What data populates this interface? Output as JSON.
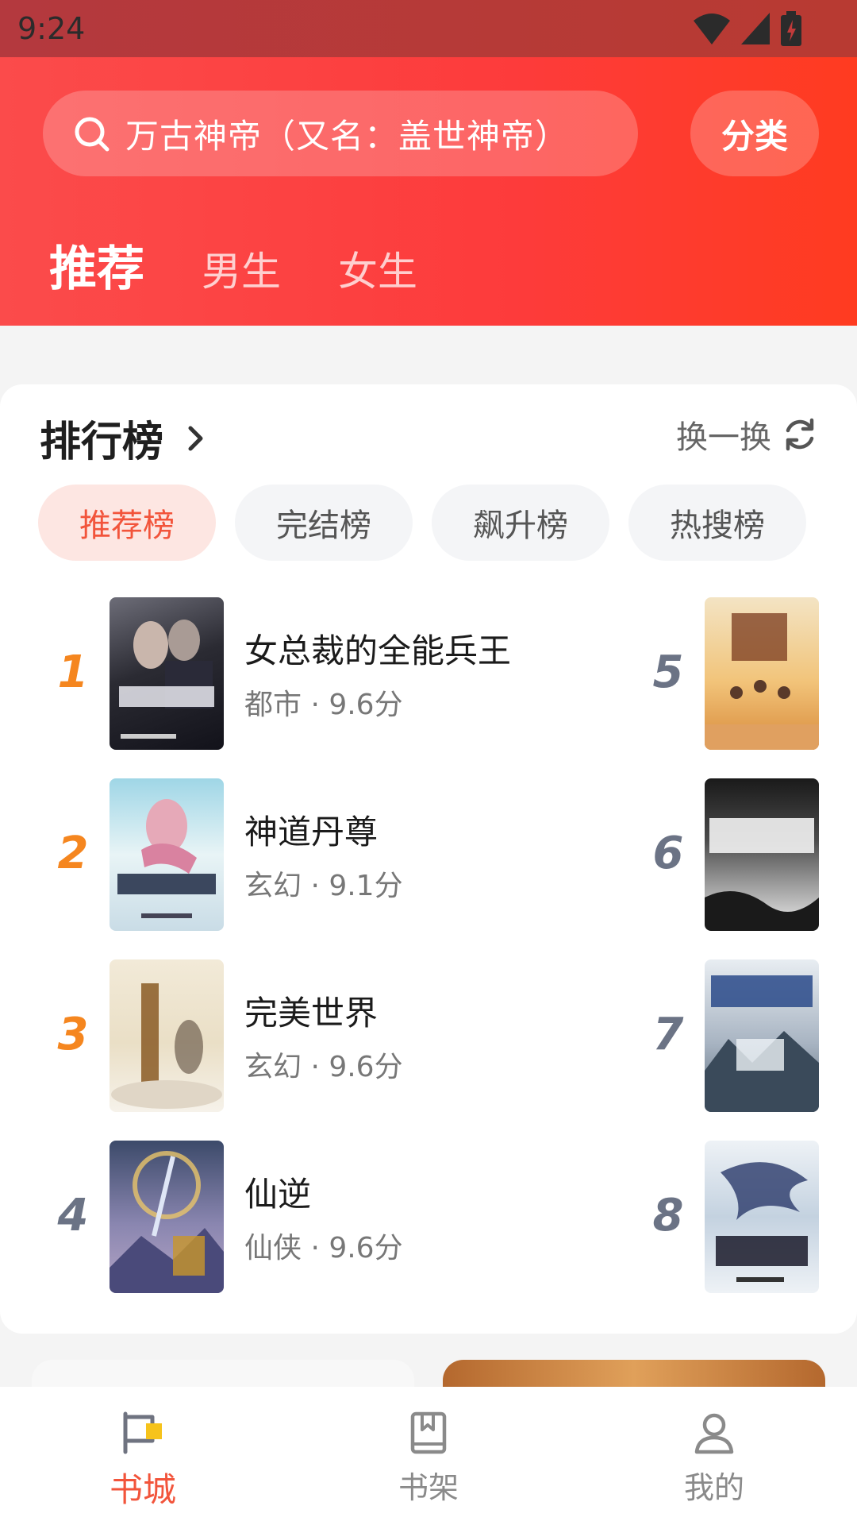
{
  "status": {
    "time": "9:24"
  },
  "search": {
    "placeholder_text": "万古神帝（又名：盖世神帝）",
    "category_label": "分类"
  },
  "tabs": [
    {
      "label": "推荐",
      "active": true
    },
    {
      "label": "男生",
      "active": false
    },
    {
      "label": "女生",
      "active": false
    }
  ],
  "ranking": {
    "title": "排行榜",
    "refresh_label": "换一换",
    "chips": [
      {
        "label": "推荐榜",
        "active": true
      },
      {
        "label": "完结榜",
        "active": false
      },
      {
        "label": "飙升榜",
        "active": false
      },
      {
        "label": "热搜榜",
        "active": false
      }
    ],
    "books": [
      {
        "rank": "1",
        "title": "女总裁的全能兵王",
        "meta": "都市 · 9.6分"
      },
      {
        "rank": "2",
        "title": "神道丹尊",
        "meta": "玄幻 · 9.1分"
      },
      {
        "rank": "3",
        "title": "完美世界",
        "meta": "玄幻 · 9.6分"
      },
      {
        "rank": "4",
        "title": "仙逆",
        "meta": "仙侠 · 9.6分"
      },
      {
        "rank": "5"
      },
      {
        "rank": "6"
      },
      {
        "rank": "7"
      },
      {
        "rank": "8"
      }
    ]
  },
  "nav": [
    {
      "label": "书城",
      "active": true,
      "icon": "bookstore-flag-icon"
    },
    {
      "label": "书架",
      "active": false,
      "icon": "bookshelf-icon"
    },
    {
      "label": "我的",
      "active": false,
      "icon": "profile-icon"
    }
  ],
  "colors": {
    "accent": "#f2543b",
    "header": "#fb4545",
    "rank_top": "#f5861f",
    "rank_other": "#6b7385"
  }
}
